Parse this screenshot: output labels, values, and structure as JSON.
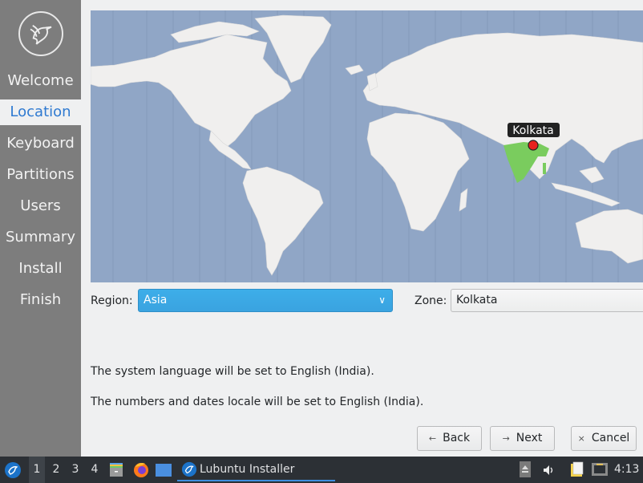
{
  "sidebar": {
    "steps": [
      {
        "label": "Welcome"
      },
      {
        "label": "Location"
      },
      {
        "label": "Keyboard"
      },
      {
        "label": "Partitions"
      },
      {
        "label": "Users"
      },
      {
        "label": "Summary"
      },
      {
        "label": "Install"
      },
      {
        "label": "Finish"
      }
    ],
    "active_step": "Location"
  },
  "map": {
    "selected_city": "Kolkata",
    "ocean_color": "#90a6c6",
    "land_color": "#f0efee",
    "highlight_color": "#7acc5e",
    "pin_color": "#e8221f"
  },
  "location": {
    "region_label": "Region:",
    "region_value": "Asia",
    "zone_label": "Zone:",
    "zone_value": "Kolkata"
  },
  "messages": {
    "language": "The system language will be set to English (India).",
    "locale": "The numbers and dates locale will be set to English (India)."
  },
  "buttons": {
    "back": "Back",
    "next": "Next",
    "cancel": "Cancel"
  },
  "taskbar": {
    "desktops": [
      "1",
      "2",
      "3",
      "4"
    ],
    "active_desktop": "1",
    "task_title": "Lubuntu Installer",
    "clock": "4:13"
  }
}
